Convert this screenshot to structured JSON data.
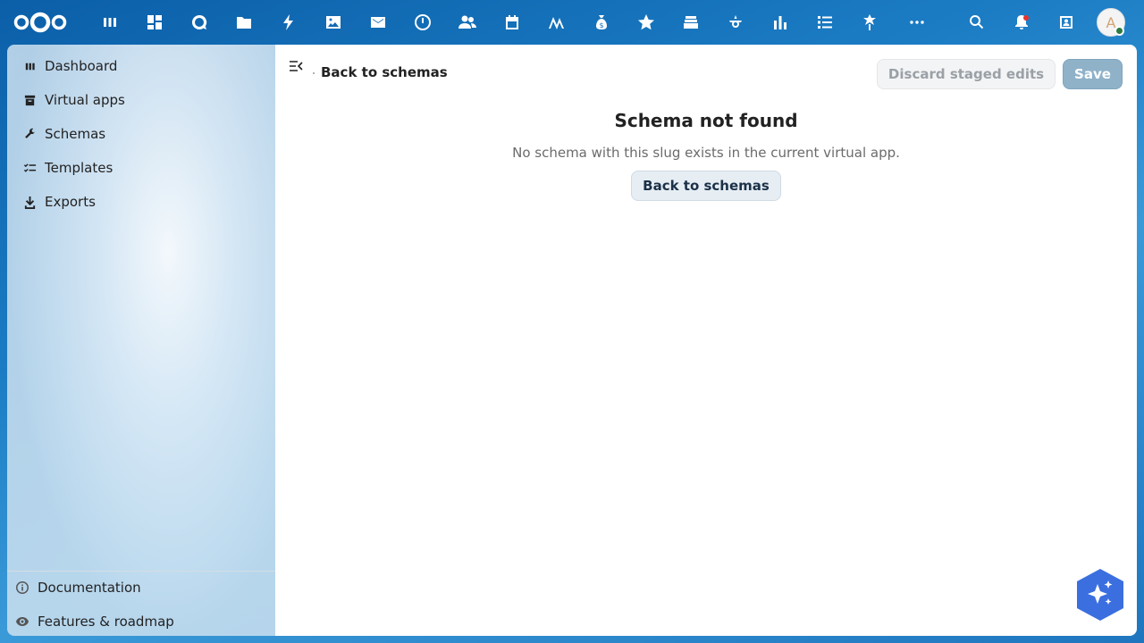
{
  "topbar": {
    "apps": [
      {
        "name": "dashboard-app"
      },
      {
        "name": "tables-app"
      },
      {
        "name": "talk-app"
      },
      {
        "name": "files-app"
      },
      {
        "name": "activity-app"
      },
      {
        "name": "photos-app"
      },
      {
        "name": "mail-app"
      },
      {
        "name": "timer-app"
      },
      {
        "name": "contacts-app"
      },
      {
        "name": "calendar-app"
      },
      {
        "name": "analytics-app"
      },
      {
        "name": "finance-app"
      },
      {
        "name": "favorites-app"
      },
      {
        "name": "deck-app"
      },
      {
        "name": "integration-app"
      },
      {
        "name": "charts-app"
      },
      {
        "name": "tasks-app"
      },
      {
        "name": "openregister-app"
      },
      {
        "name": "more-apps"
      }
    ],
    "avatar_letter": "A"
  },
  "sidebar": {
    "items": [
      {
        "label": "Dashboard",
        "icon": "dashboard-icon"
      },
      {
        "label": "Virtual apps",
        "icon": "archive-icon"
      },
      {
        "label": "Schemas",
        "icon": "wrench-icon"
      },
      {
        "label": "Templates",
        "icon": "checklist-icon"
      },
      {
        "label": "Exports",
        "icon": "download-icon"
      }
    ],
    "footer": [
      {
        "label": "Documentation",
        "icon": "info-icon"
      },
      {
        "label": "Features & roadmap",
        "icon": "eye-icon"
      }
    ]
  },
  "header": {
    "back_label": "Back to schemas",
    "discard_label": "Discard staged edits",
    "save_label": "Save"
  },
  "empty_state": {
    "title": "Schema not found",
    "description": "No schema with this slug exists in the current virtual app.",
    "button_label": "Back to schemas"
  },
  "colors": {
    "accent": "#0082c9",
    "assistant": "#3b6fe0"
  }
}
